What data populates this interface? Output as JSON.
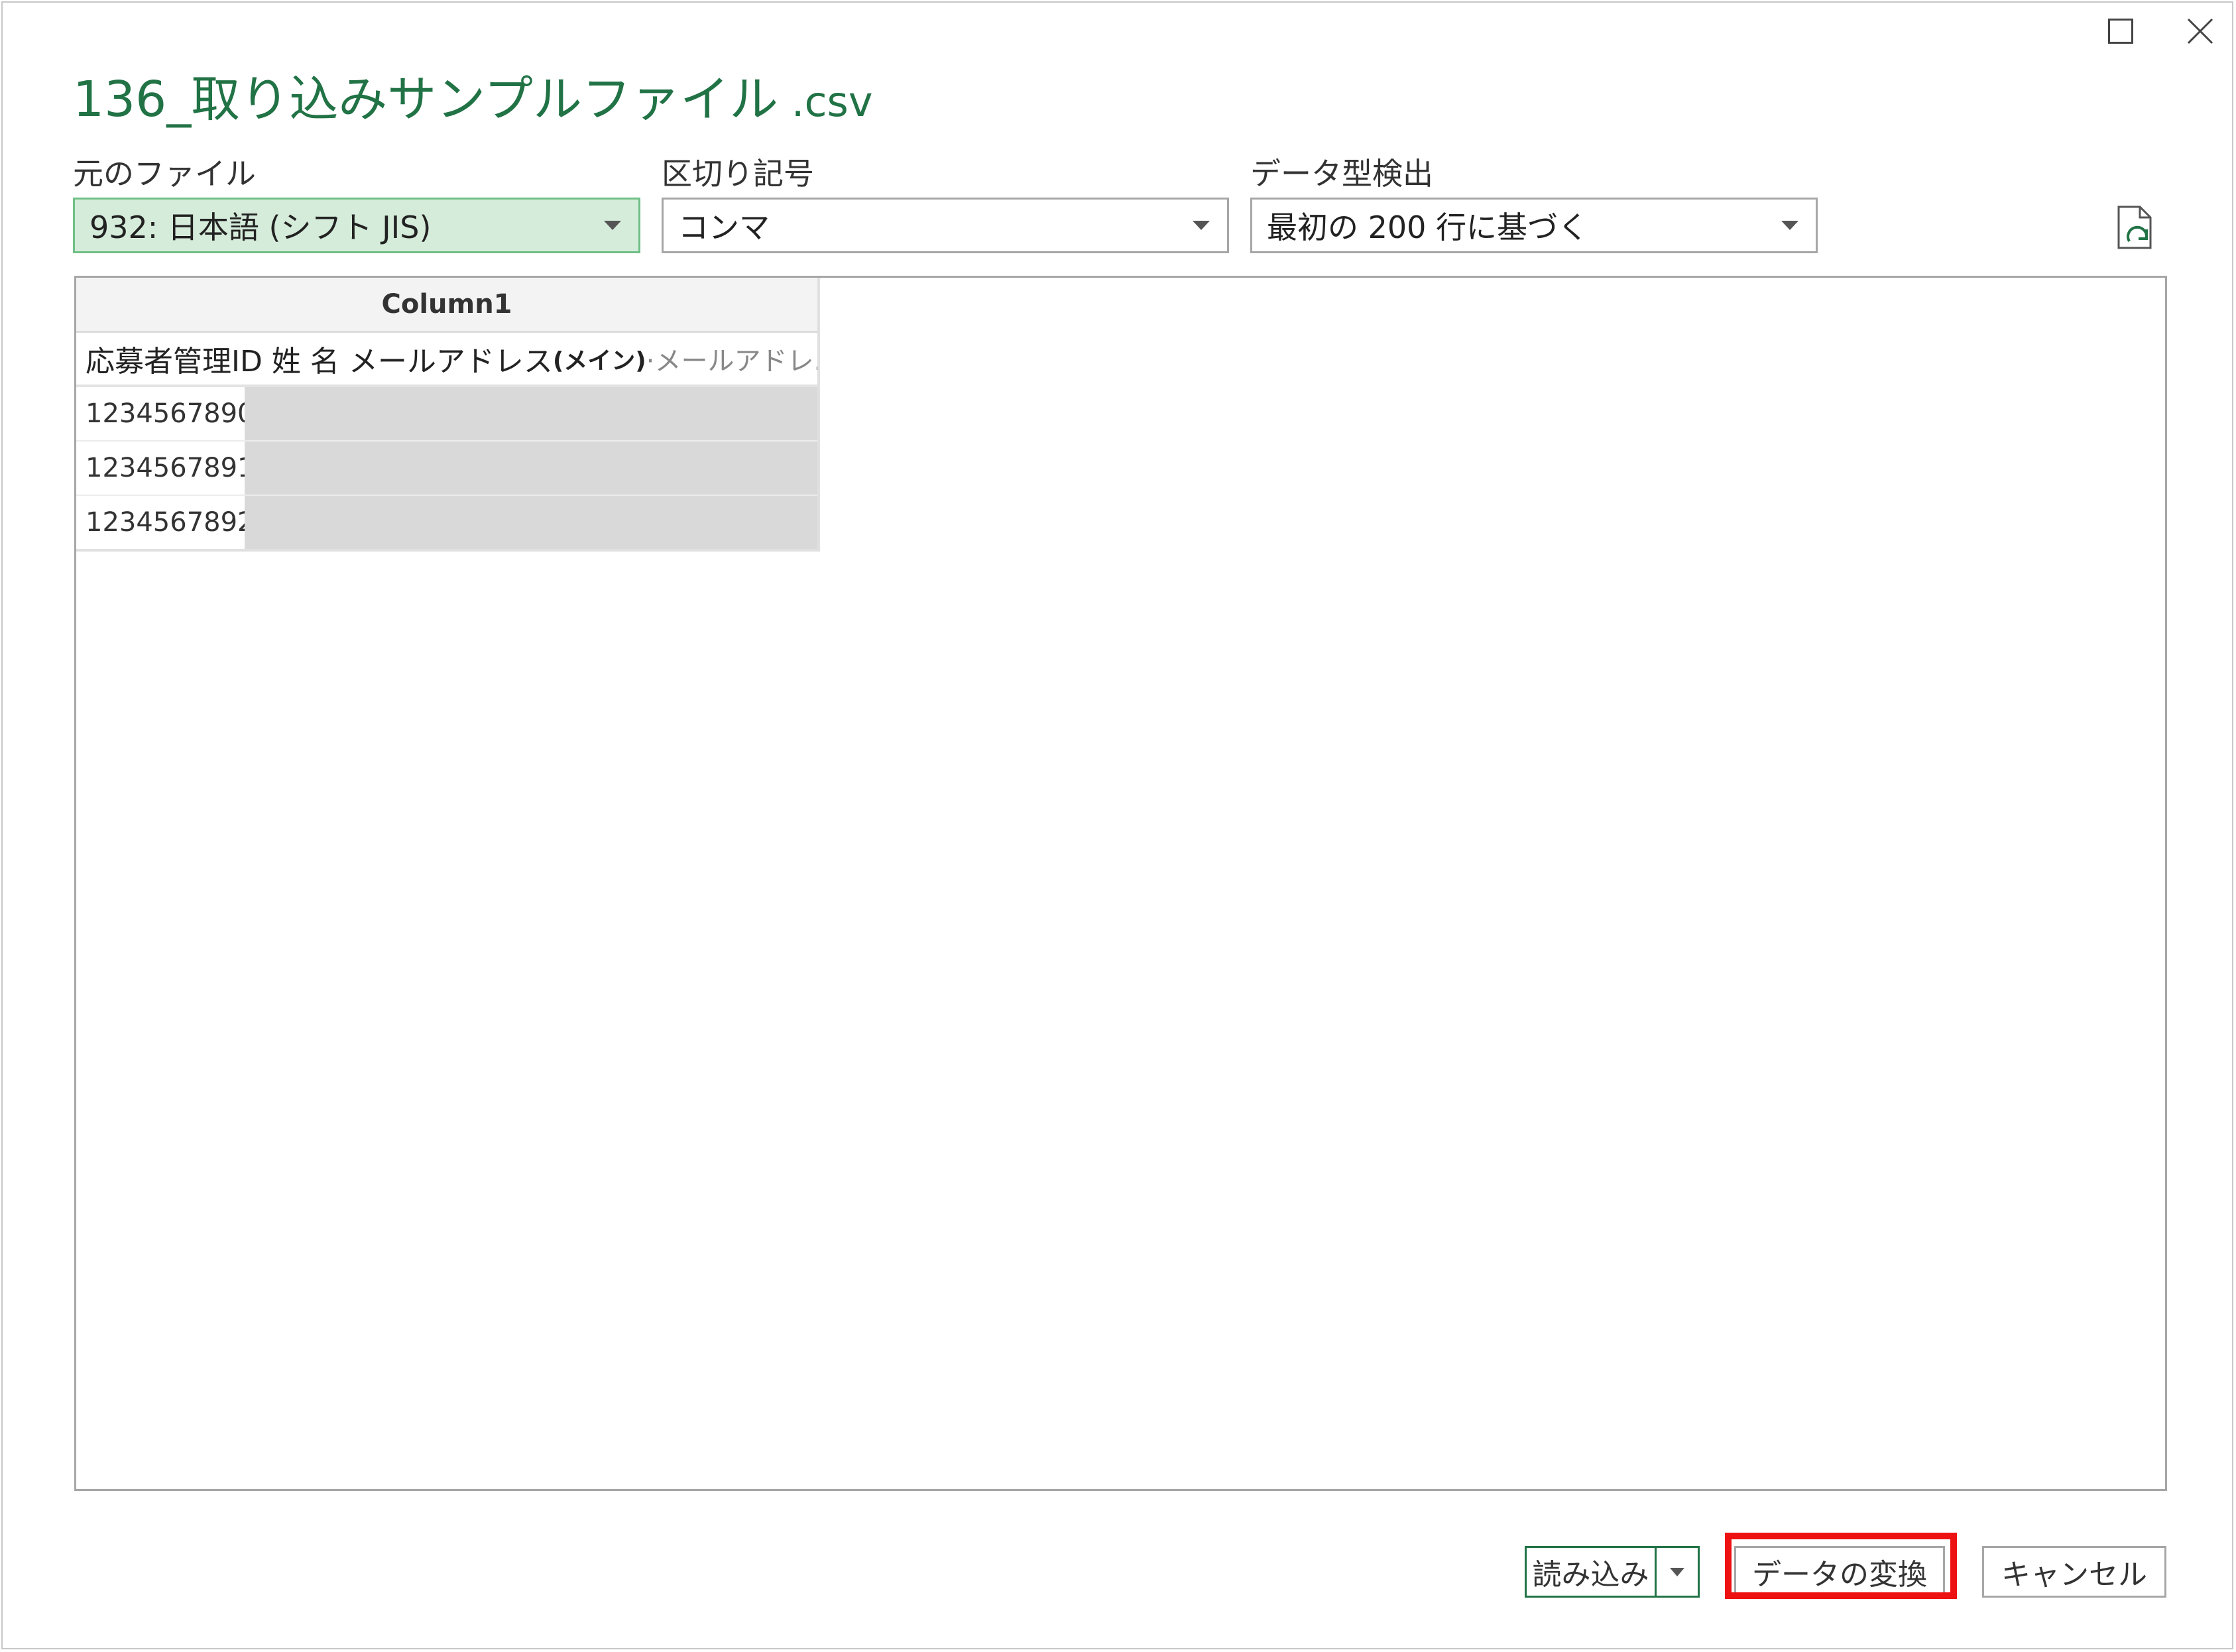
{
  "window": {
    "title": "136_取り込みサンプルファイル",
    "title_ext": " .csv",
    "maximize_icon": "maximize-icon",
    "close_icon": "close-icon"
  },
  "fields": {
    "file_origin": {
      "label": "元のファイル",
      "value": "932: 日本語 (シフト JIS)"
    },
    "delimiter": {
      "label": "区切り記号",
      "value": "コンマ"
    },
    "type_detection": {
      "label": "データ型検出",
      "value": "最初の 200 行に基づく"
    },
    "refresh_icon": "refresh-file-icon"
  },
  "preview": {
    "column_header": "Column1",
    "first_row": {
      "text_main": "応募者管理ID 姓 名 メールアドレス",
      "text_bold": "(メイン)",
      "text_muted": "·メールアドレ..."
    },
    "rows": [
      {
        "id": "1234567890"
      },
      {
        "id": "1234567891"
      },
      {
        "id": "1234567892"
      }
    ]
  },
  "actions": {
    "load_label": "読み込み",
    "transform_label": "データの変換",
    "cancel_label": "キャンセル"
  },
  "colors": {
    "accent_green": "#217346",
    "highlight_red": "#ee1111",
    "masked_cell": "#d9d9d9"
  }
}
